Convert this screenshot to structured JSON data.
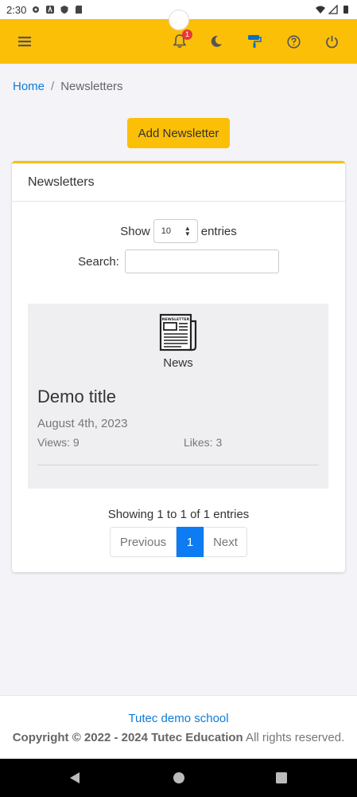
{
  "status_bar": {
    "time": "2:30",
    "left_icons": [
      "settings-gear-icon",
      "font-a-icon",
      "shield-icon",
      "sd-card-icon"
    ],
    "right_icons": [
      "wifi-icon",
      "signal-icon",
      "battery-icon"
    ]
  },
  "topbar": {
    "color": "#fbbf08",
    "icons": [
      "menu-icon",
      "bell-icon",
      "moon-icon",
      "paint-roller-icon",
      "help-icon",
      "power-icon"
    ],
    "notification_count": "1"
  },
  "breadcrumb": {
    "home": "Home",
    "separator": "/",
    "current": "Newsletters"
  },
  "add_button_label": "Add Newsletter",
  "card": {
    "title": "Newsletters",
    "show_label": "Show",
    "entries_value": "10",
    "entries_label": "entries",
    "search_label": "Search:",
    "search_value": "",
    "items": [
      {
        "icon_text": "NEWSLETTER",
        "category": "News",
        "title": "Demo title",
        "date": "August 4th, 2023",
        "views": "Views: 9",
        "likes": "Likes: 3"
      }
    ],
    "info": "Showing 1 to 1 of 1 entries",
    "pagination": {
      "previous": "Previous",
      "current": "1",
      "next": "Next"
    }
  },
  "footer": {
    "school": "Tutec demo school",
    "copyright_bold": "Copyright © 2022 - 2024 Tutec Education",
    "copyright_rest": " All rights reserved."
  },
  "colors": {
    "accent": "#fbbf08",
    "link": "#0d7bd8",
    "active_page": "#0d7bf2"
  }
}
